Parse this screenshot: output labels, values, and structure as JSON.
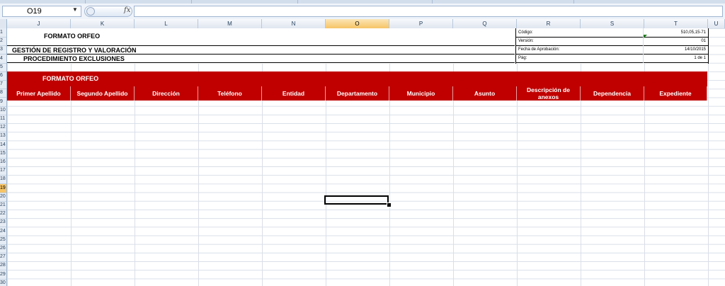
{
  "formula_bar": {
    "name_box": "O19",
    "fx_label": "fx",
    "formula": ""
  },
  "columns": [
    "J",
    "K",
    "L",
    "M",
    "N",
    "O",
    "P",
    "Q",
    "R",
    "S",
    "T",
    "U"
  ],
  "selected_column": "O",
  "rows": [
    "1",
    "2",
    "3",
    "4",
    "5",
    "6",
    "7",
    "8",
    "9",
    "10",
    "11",
    "12",
    "13",
    "14",
    "15",
    "16",
    "17",
    "18",
    "19",
    "20",
    "21",
    "22",
    "23",
    "24",
    "25",
    "26",
    "27",
    "28",
    "29",
    "30"
  ],
  "selected_row": "19",
  "sheet": {
    "formato_title": "FORMATO ORFEO",
    "gestion_title": "GESTIÓN DE REGISTRO Y VALORACIÓN",
    "procedimiento_title": "PROCEDIMIENTO EXCLUSIONES",
    "meta": [
      {
        "label": "Código:",
        "value": "510,05,15-71"
      },
      {
        "label": "Versión:",
        "value": "01"
      },
      {
        "label": "Fecha de Aprobación:",
        "value": "14/10/2015"
      },
      {
        "label": "Pág:",
        "value": "1 de 1"
      }
    ],
    "red_title": "FORMATO ORFEO",
    "red_headers": [
      "Primer Apellido",
      "Segundo Apellido",
      "Dirección",
      "Teléfono",
      "Entidad",
      "Departamento",
      "Municipio",
      "Asunto",
      "Descripción de anexos",
      "Dependencia",
      "Expediente"
    ]
  },
  "colors": {
    "header_red": "#c00000",
    "selected_header": "#f6c466",
    "gridline": "#d9dfe8"
  }
}
